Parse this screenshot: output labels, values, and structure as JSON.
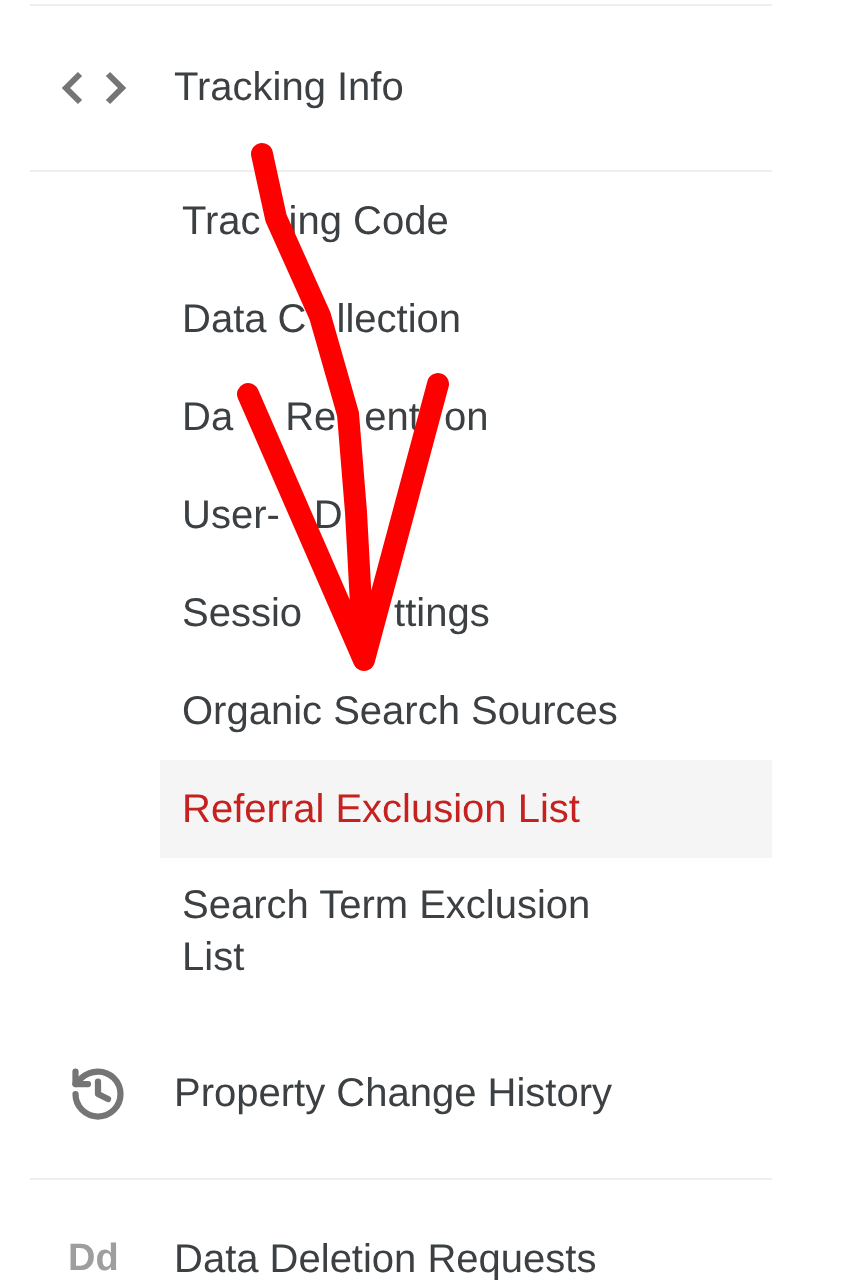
{
  "section": {
    "label": "Tracking Info",
    "children": [
      {
        "label": [
          "Trac",
          "ing Code"
        ],
        "selected": false
      },
      {
        "label": [
          "Data C",
          "llection"
        ],
        "selected": false
      },
      {
        "label": [
          "Da",
          "Re",
          "ent",
          "on"
        ],
        "selected": false
      },
      {
        "label": [
          "User-",
          "D"
        ],
        "selected": false
      },
      {
        "label": [
          "Sessio",
          "ttings"
        ],
        "selected": false
      },
      {
        "label": [
          "Organic Search Sources"
        ],
        "selected": false
      },
      {
        "label": [
          "Referral Exclusion List"
        ],
        "selected": true
      },
      {
        "label": [
          "Search Term Exclusion List"
        ],
        "selected": false
      }
    ]
  },
  "links": [
    {
      "label": "Property Change History"
    },
    {
      "label": "Data Deletion Requests",
      "icon_text": "Dd"
    }
  ]
}
